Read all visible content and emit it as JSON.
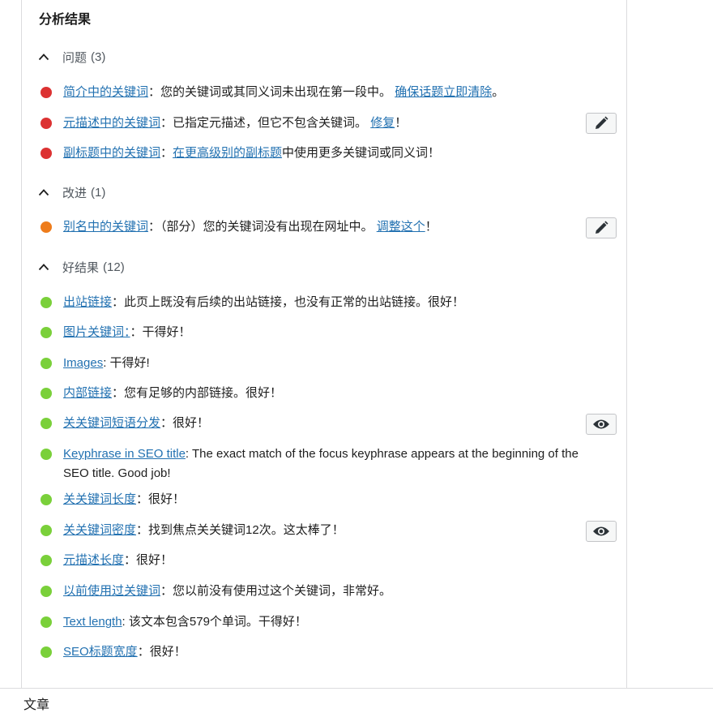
{
  "title": "分析结果",
  "colors": {
    "bad": "#dc3232",
    "ok": "#ee7c1b",
    "good": "#7ad03a",
    "link": "#2271b1"
  },
  "groups": {
    "problems": {
      "label": "问题",
      "count": "(3)"
    },
    "improvements": {
      "label": "改进",
      "count": "(1)"
    },
    "good": {
      "label": "好结果",
      "count": "(12)"
    }
  },
  "items": {
    "p1": {
      "link": "简介中的关键词",
      "text": "：您的关键词或其同义词未出现在第一段中。 ",
      "fix": "确保话题立即清除",
      "tail": "。"
    },
    "p2": {
      "link": "元描述中的关键词",
      "text": "：已指定元描述，但它不包含关键词。 ",
      "fix": "修复",
      "tail": "！"
    },
    "p3": {
      "link": "副标题中的关键词",
      "sep": "：",
      "fix": "在更高级别的副标题",
      "tail": "中使用更多关键词或同义词！"
    },
    "i1": {
      "link": "别名中的关键词",
      "text": "：（部分）您的关键词没有出现在网址中。 ",
      "fix": "调整这个",
      "tail": "！"
    },
    "g1": {
      "link": "出站链接",
      "text": "：此页上既没有后续的出站链接，也没有正常的出站链接。很好！"
    },
    "g2": {
      "link": "图片关键词：",
      "text": "：干得好！"
    },
    "g3": {
      "link": "Images",
      "text": ": 干得好!"
    },
    "g4": {
      "link": "内部链接",
      "text": "：您有足够的内部链接。很好！"
    },
    "g5": {
      "link": "关关键词短语分发",
      "text": "：很好！"
    },
    "g6": {
      "link": "Keyphrase in SEO title",
      "text": ": The exact match of the focus keyphrase appears at the beginning of the SEO title. Good job!"
    },
    "g7": {
      "link": "关关键词长度",
      "text": "：很好！"
    },
    "g8": {
      "link": "关关键词密度",
      "text": "：找到焦点关关键词12次。这太棒了！"
    },
    "g9": {
      "link": "元描述长度",
      "text": "：很好！"
    },
    "g10": {
      "link": "以前使用过关键词",
      "text": "：您以前没有使用过这个关键词，非常好。"
    },
    "g11": {
      "link": "Text length",
      "text": ": 该文本包含579个单词。干得好！"
    },
    "g12": {
      "link": "SEO标题宽度",
      "text": "：很好！"
    }
  },
  "icons": {
    "edit": "pencil-icon",
    "view": "eye-icon",
    "collapse": "chevron-up-icon"
  },
  "footer": {
    "label": "文章"
  }
}
